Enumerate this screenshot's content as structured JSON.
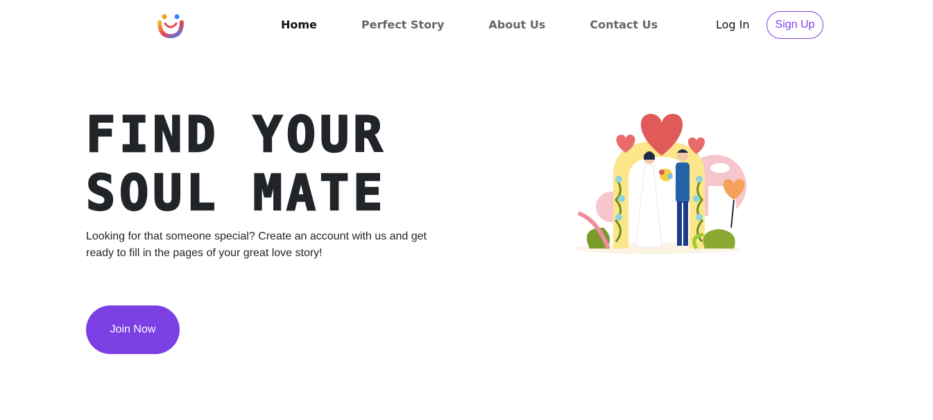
{
  "nav": {
    "logo_icon": "smiling-couple-logo-icon",
    "links": [
      "Home",
      "Perfect Story",
      "About Us",
      "Contact Us"
    ],
    "active": "Home",
    "login_label": "Log In",
    "signup_label": "Sign Up"
  },
  "hero": {
    "title_line1": "FIND YOUR",
    "title_line2": "SOUL MATE",
    "description": "Looking for that someone special? Create an account with us and get ready to fill in the pages of your great love story!",
    "cta_label": "Join Now",
    "illustration": "wedding-couple-arch-illustration"
  },
  "colors": {
    "accent": "#7b3fe4",
    "heading": "#212529",
    "nav_inactive": "#666666",
    "heart": "#e05a5a"
  }
}
